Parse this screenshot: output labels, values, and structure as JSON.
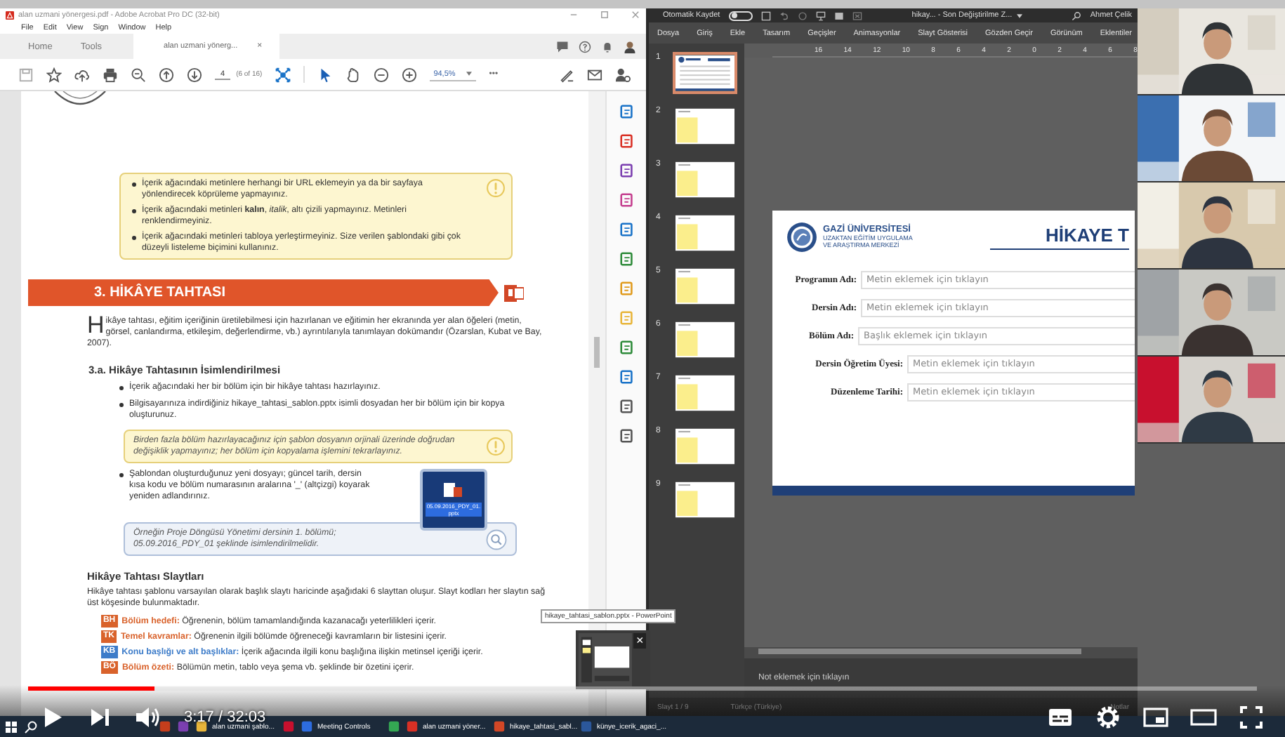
{
  "acrobat": {
    "title": "alan uzmani yönergesi.pdf - Adobe Acrobat Pro DC (32-bit)",
    "menu": [
      "File",
      "Edit",
      "View",
      "Sign",
      "Window",
      "Help"
    ],
    "tabs": [
      {
        "label": "Home",
        "selected": false
      },
      {
        "label": "Tools",
        "selected": false
      },
      {
        "label": "alan uzmani yönerg...",
        "selected": true
      }
    ],
    "tab_close": "×",
    "page_number": "4",
    "page_count": "(6 of 16)",
    "zoom": "94,5%",
    "more": "•••",
    "document": {
      "notice_items": [
        "İçerik ağacındaki metinlere herhangi bir URL eklemeyin ya da bir sayfaya yönlendirecek köprüleme yapmayınız.",
        "İçerik ağacındaki metinleri **kalın**, *italik*, altı çizili yapmayınız. Metinleri renklendirmeyiniz.",
        "İçerik ağacındaki metinleri tabloya yerleştirmeyiniz. Size verilen şablondaki gibi çok düzeyli listeleme biçimini kullanınız."
      ],
      "section_title": "3. HİKÂYE TAHTASI",
      "intro_initial": "H",
      "intro": "ikâye tahtası, eğitim içeriğinin üretilebilmesi için hazırlanan ve eğitimin her ekranında yer alan öğeleri (metin, görsel, canlandırma, etkileşim, değerlendirme, vb.) ayrıntılarıyla tanımlayan dokümandır (Özarslan, Kubat ve Bay, 2007).",
      "subheading": "3.a. Hikâye Tahtasının İsimlendirilmesi",
      "bullets": [
        "İçerik ağacındaki her bir bölüm için bir hikâye tahtası hazırlayınız.",
        "Bilgisayarınıza indirdiğiniz hikaye_tahtasi_sablon.pptx isimli dosyadan her bir bölüm için bir kopya oluşturunuz."
      ],
      "warning": "Birden fazla bölüm hazırlayacağınız için şablon dosyanın orjinali üzerinde doğrudan değişiklik yapmayınız; her bölüm için kopyalama işlemini tekrarlayınız.",
      "rename_bullet": "Şablondan oluşturduğunuz yeni dosyayı; güncel tarih, dersin kısa kodu ve bölüm numarasının aralarına '_' (altçizgi) koyarak yeniden adlandırınız.",
      "file_name": "05.09.2016_PDY_01.pptx",
      "example": "Örneğin Proje Döngüsü Yönetimi dersinin 1. bölümü; 05.09.2016_PDY_01 şeklinde isimlendirilmelidir.",
      "slides_heading": "Hikâye Tahtası Slaytları",
      "slides_intro": "Hikâye tahtası şablonu varsayılan olarak başlık slaytı haricinde aşağıdaki 6 slayttan oluşur. Slayt kodları her slaytın sağ üst köşesinde bulunmaktadır.",
      "codes": [
        {
          "code": "BH",
          "name": "Bölüm hedefi:",
          "text": "Öğrenenin, bölüm tamamlandığında kazanacağı yeterlilikleri içerir.",
          "color": "#d9622b"
        },
        {
          "code": "TK",
          "name": "Temel kavramlar:",
          "text": "Öğrenenin ilgili bölümde öğreneceği kavramların bir listesini içerir.",
          "color": "#d9622b"
        },
        {
          "code": "KB",
          "name": "Konu başlığı ve alt başlıklar:",
          "text": "İçerik ağacında ilgili konu başlığına ilişkin metinsel içeriği içerir.",
          "color": "#3d7cc9"
        },
        {
          "code": "BÖ",
          "name": "Bölüm özeti:",
          "text": "Bölümün metin, tablo veya şema vb. şeklinde bir özetini içerir.",
          "color": "#d9622b"
        }
      ]
    }
  },
  "tooltip": "hikaye_tahtasi_sablon.pptx - PowerPoint",
  "preview_close": "×",
  "powerpoint": {
    "autosave": "Otomatik Kaydet",
    "autosave_on": false,
    "title": "hikay... - Son Değiştirilme Z...",
    "user": "Ahmet Çelik",
    "tabs": [
      "Dosya",
      "Giriş",
      "Ekle",
      "Tasarım",
      "Geçişler",
      "Animasyonlar",
      "Slayt Gösterisi",
      "Gözden Geçir",
      "Görünüm",
      "Eklentiler"
    ],
    "ruler": [
      "16",
      "14",
      "12",
      "10",
      "8",
      "6",
      "4",
      "2",
      "0",
      "2",
      "4",
      "6",
      "8"
    ],
    "slides": [
      {
        "number": "1",
        "kind": "title",
        "selected": true
      },
      {
        "number": "2",
        "kind": "content",
        "selected": false
      },
      {
        "number": "3",
        "kind": "content",
        "selected": false
      },
      {
        "number": "4",
        "kind": "content",
        "selected": false
      },
      {
        "number": "5",
        "kind": "content",
        "selected": false
      },
      {
        "number": "6",
        "kind": "content",
        "selected": false
      },
      {
        "number": "7",
        "kind": "content",
        "selected": false
      },
      {
        "number": "8",
        "kind": "content",
        "selected": false
      },
      {
        "number": "9",
        "kind": "content",
        "selected": false
      }
    ],
    "slide": {
      "university": "GAZİ ÜNİVERSİTESİ",
      "center_lines": [
        "UZAKTAN EĞİTİM UYGULAMA",
        "VE ARAŞTIRMA MERKEZİ"
      ],
      "title": "HİKAYE T",
      "fields": [
        {
          "label": "Programın Adı:",
          "placeholder": "Metin eklemek için tıklayın"
        },
        {
          "label": "Dersin Adı:",
          "placeholder": "Metin eklemek için tıklayın"
        },
        {
          "label": "Bölüm Adı:",
          "placeholder": "Başlık eklemek için tıklayın"
        },
        {
          "label": "Dersin Öğretim Üyesi:",
          "placeholder": "Metin eklemek için tıklayın"
        },
        {
          "label": "Düzenleme Tarihi:",
          "placeholder": "Metin eklemek için tıklayın"
        }
      ]
    },
    "notes": "Not eklemek için tıklayın",
    "status": [
      "Slayt 1 / 9",
      "Türkçe (Türkiye)"
    ],
    "notes_button": "Notlar"
  },
  "taskbar": [
    {
      "color": "#c43e1c"
    },
    {
      "color": "#7b3fb0"
    },
    {
      "label": "alan uzmani şablo...",
      "color": "#e8b53a"
    },
    {
      "color": "#c8102e"
    },
    {
      "label": "Meeting Controls",
      "color": "#2d6cdf"
    },
    {
      "color": "#34a853"
    },
    {
      "label": "alan uzmani yöner...",
      "color": "#d93025"
    },
    {
      "label": "hikaye_tahtasi_sabl...",
      "color": "#d24726"
    },
    {
      "label": "künye_icerik_agaci_...",
      "color": "#2b579a"
    }
  ],
  "player": {
    "time": "3:17 / 32:03",
    "level": 0.103
  }
}
